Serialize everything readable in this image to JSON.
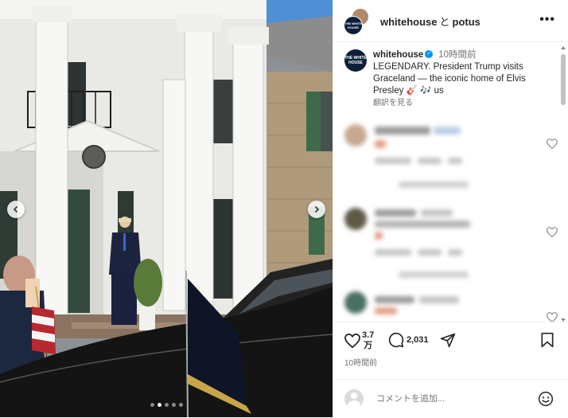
{
  "photo": {
    "prev_label": "前へ",
    "next_label": "次へ",
    "slide_count": 5,
    "active_slide": 2
  },
  "header": {
    "account1": "whitehouse",
    "connector": "と",
    "account2": "potus",
    "more_glyph": "•••"
  },
  "caption": {
    "username": "whitehouse",
    "verified_glyph": "✓",
    "time": "10時間前",
    "text": "LEGENDARY. President Trump visits Graceland — the iconic home of Elvis Presley 🎸 🎶 us",
    "translate": "翻訳を見る",
    "avatar_text": "THE WHITE HOUSE"
  },
  "actions": {
    "likes_top": "3.7",
    "likes_bottom": "万",
    "comments": "2,031",
    "time": "10時間前"
  },
  "add_comment": {
    "placeholder": "コメントを追加..."
  },
  "colors": {
    "accent": "#0095f6",
    "text": "#262626",
    "muted": "#737373",
    "divider": "#efefef"
  }
}
